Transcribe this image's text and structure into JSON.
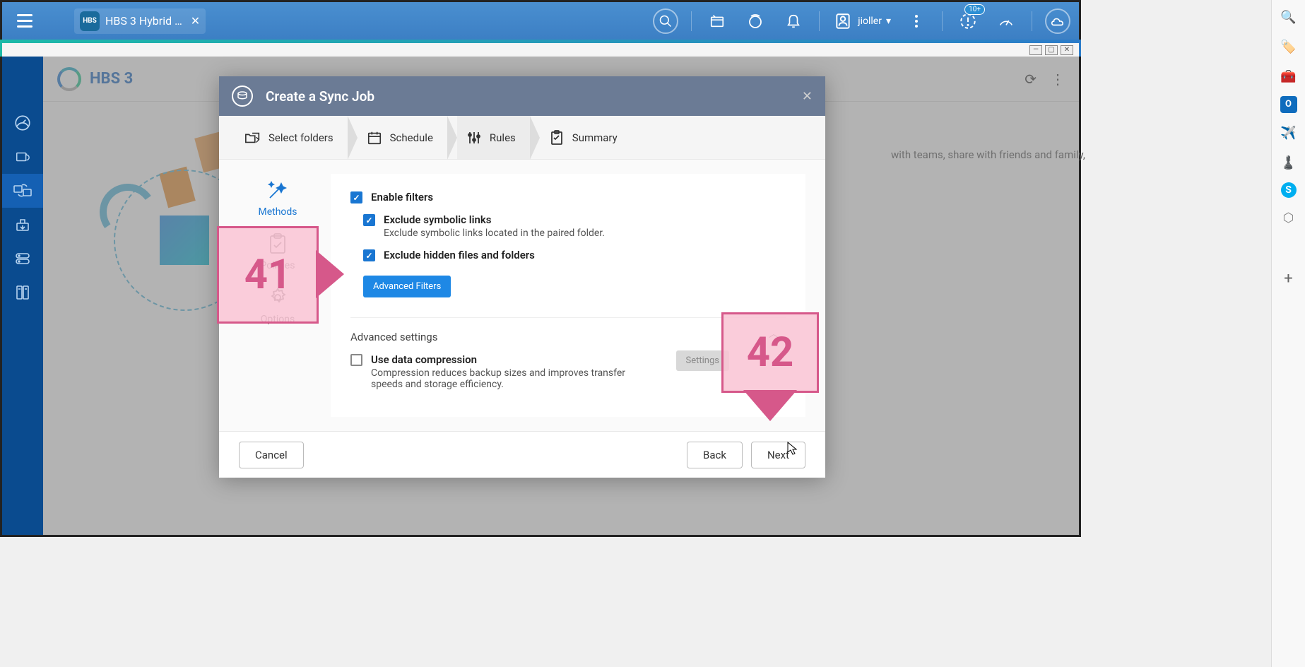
{
  "top": {
    "tab_title": "HBS 3 Hybrid …",
    "user": "jioller",
    "badge": "10+"
  },
  "app": {
    "title": "HBS 3",
    "bg_text": "with teams, share with friends and family,"
  },
  "dialog": {
    "title": "Create a Sync Job",
    "steps": {
      "folders": "Select folders",
      "schedule": "Schedule",
      "rules": "Rules",
      "summary": "Summary"
    },
    "rules_nav": {
      "methods": "Methods",
      "policies": "Policies",
      "options": "Options"
    },
    "filters": {
      "enable": "Enable filters",
      "exclude_symlinks": "Exclude symbolic links",
      "exclude_symlinks_desc": "Exclude symbolic links located in the paired folder.",
      "exclude_hidden": "Exclude hidden files and folders",
      "advanced_btn": "Advanced Filters"
    },
    "advanced": {
      "title": "Advanced settings",
      "compression": "Use data compression",
      "compression_desc": "Compression reduces backup sizes and improves transfer speeds and storage efficiency.",
      "settings_btn": "Settings"
    },
    "footer": {
      "cancel": "Cancel",
      "back": "Back",
      "next": "Next"
    }
  },
  "callouts": {
    "a": "41",
    "b": "42"
  }
}
